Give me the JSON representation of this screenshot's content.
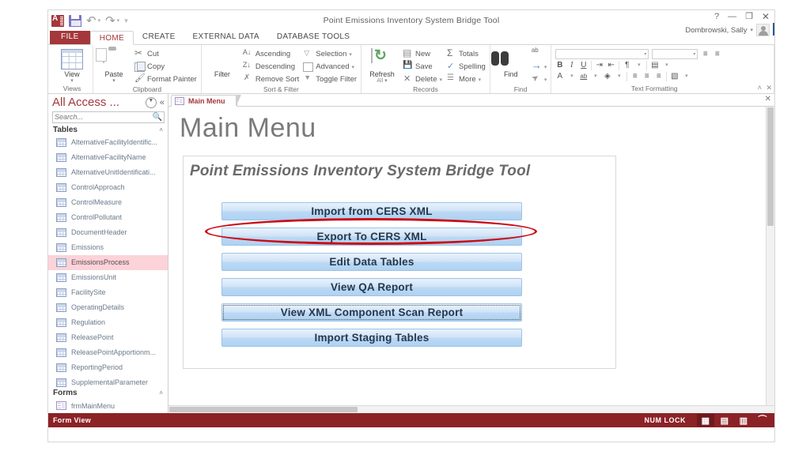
{
  "window": {
    "title": "Point Emissions Inventory System Bridge Tool",
    "account_name": "Dombrowski, Sally",
    "help_icon": "help-icon",
    "minimize_icon": "minimize-icon",
    "restore_icon": "restore-icon",
    "close_icon": "close-icon"
  },
  "quick_access": {
    "app_icon": "access-app-icon",
    "save_icon": "save-icon",
    "undo_icon": "undo-icon",
    "redo_icon": "redo-icon",
    "customize_icon": "customize-qat-icon"
  },
  "ribbon": {
    "tabs": [
      {
        "label": "FILE",
        "active": false,
        "file": true
      },
      {
        "label": "HOME",
        "active": true,
        "file": false
      },
      {
        "label": "CREATE",
        "active": false,
        "file": false
      },
      {
        "label": "EXTERNAL DATA",
        "active": false,
        "file": false
      },
      {
        "label": "DATABASE TOOLS",
        "active": false,
        "file": false
      }
    ],
    "groups": {
      "views": {
        "label": "Views",
        "view_label": "View",
        "view_caret": "▾"
      },
      "clipboard": {
        "label": "Clipboard",
        "paste_label": "Paste",
        "paste_caret": "▾",
        "cut_label": "Cut",
        "copy_label": "Copy",
        "format_painter_label": "Format Painter",
        "dialog_launcher": "↘"
      },
      "sort_filter": {
        "label": "Sort & Filter",
        "filter_label": "Filter",
        "ascending_label": "Ascending",
        "descending_label": "Descending",
        "remove_sort_label": "Remove Sort",
        "selection_label": "Selection",
        "advanced_label": "Advanced",
        "toggle_filter_label": "Toggle Filter",
        "caret": "▾"
      },
      "records": {
        "label": "Records",
        "refresh_label": "Refresh",
        "refresh_sub": "All",
        "refresh_caret": "▾",
        "new_label": "New",
        "save_label": "Save",
        "delete_label": "Delete",
        "delete_caret": "▾",
        "totals_label": "Totals",
        "spelling_label": "Spelling",
        "more_label": "More",
        "more_caret": "▾"
      },
      "find": {
        "label": "Find",
        "find_label": "Find",
        "replace_label": "ab→ac",
        "goto_label": "→",
        "select_label": "➤",
        "caret": "▾"
      },
      "text_formatting": {
        "label": "Text Formatting",
        "font_value": "",
        "size_value": "",
        "bold": "B",
        "italic": "I",
        "underline": "U",
        "bullets_icon": "bulleted-list-icon",
        "numbering_icon": "numbered-list-icon",
        "indent_increase_icon": "increase-indent-icon",
        "indent_decrease_icon": "decrease-indent-icon",
        "rtl_icon": "text-direction-icon",
        "gridline_icon": "gridlines-icon",
        "font_color": "A",
        "highlight": "ab",
        "fill_icon": "fill-color-icon",
        "align_left_icon": "align-left-icon",
        "align_center_icon": "align-center-icon",
        "align_right_icon": "align-right-icon",
        "alt_fill_icon": "alternate-row-color-icon",
        "dialog_launcher": "↘"
      }
    },
    "collapse_icon": "˄",
    "doc_close_icon": "✕"
  },
  "nav_pane": {
    "title": "All Access ...",
    "dropdown_icon": "shutter-bar-dropdown-icon",
    "collapse_icon": "«",
    "search_placeholder": "Search...",
    "search_value": "",
    "search_icon": "search-icon",
    "sections": [
      {
        "name": "Tables",
        "collapse_icon": "˄",
        "items": [
          {
            "label": "AlternativeFacilityIdentific...",
            "selected": false
          },
          {
            "label": "AlternativeFacilityName",
            "selected": false
          },
          {
            "label": "AlternativeUnitIdentificati...",
            "selected": false
          },
          {
            "label": "ControlApproach",
            "selected": false
          },
          {
            "label": "ControlMeasure",
            "selected": false
          },
          {
            "label": "ControlPollutant",
            "selected": false
          },
          {
            "label": "DocumentHeader",
            "selected": false
          },
          {
            "label": "Emissions",
            "selected": false
          },
          {
            "label": "EmissionsProcess",
            "selected": true
          },
          {
            "label": "EmissionsUnit",
            "selected": false
          },
          {
            "label": "FacilitySite",
            "selected": false
          },
          {
            "label": "OperatingDetails",
            "selected": false
          },
          {
            "label": "Regulation",
            "selected": false
          },
          {
            "label": "ReleasePoint",
            "selected": false
          },
          {
            "label": "ReleasePointApportionm...",
            "selected": false
          },
          {
            "label": "ReportingPeriod",
            "selected": false
          },
          {
            "label": "SupplementalParameter",
            "selected": false
          }
        ]
      },
      {
        "name": "Forms",
        "collapse_icon": "˄",
        "items": [
          {
            "label": "frmMainMenu",
            "selected": false
          }
        ]
      }
    ]
  },
  "document": {
    "tab_label": "Main Menu",
    "tab_icon": "form-icon",
    "tab_close_icon": "✕"
  },
  "form": {
    "page_title": "Main Menu",
    "header_text": "Point Emissions Inventory System Bridge Tool",
    "buttons": [
      {
        "label": "Import from CERS XML",
        "focused": false,
        "annotated": false
      },
      {
        "label": "Export To CERS XML",
        "focused": false,
        "annotated": true
      },
      {
        "label": "Edit Data Tables",
        "focused": false,
        "annotated": false
      },
      {
        "label": "View QA Report",
        "focused": false,
        "annotated": false
      },
      {
        "label": "View XML Component Scan Report",
        "focused": true,
        "annotated": false
      },
      {
        "label": "Import Staging Tables",
        "focused": false,
        "annotated": false
      }
    ],
    "annotation": {
      "shape": "ellipse",
      "color": "#cc0a14",
      "targets": "Export To CERS XML"
    }
  },
  "status_bar": {
    "mode_label": "Form View",
    "num_lock_label": "NUM LOCK",
    "view_buttons": [
      {
        "icon": "form-view-icon",
        "active": true
      },
      {
        "icon": "datasheet-view-icon",
        "active": false
      },
      {
        "icon": "layout-view-icon",
        "active": false
      },
      {
        "icon": "design-view-icon",
        "active": false
      }
    ]
  },
  "colors": {
    "accent_red": "#a4373a",
    "status_bar": "#8b2226",
    "selection_pink": "#fbd3d8",
    "button_blue": "#aed2f2",
    "annotation_red": "#cc0a14"
  }
}
